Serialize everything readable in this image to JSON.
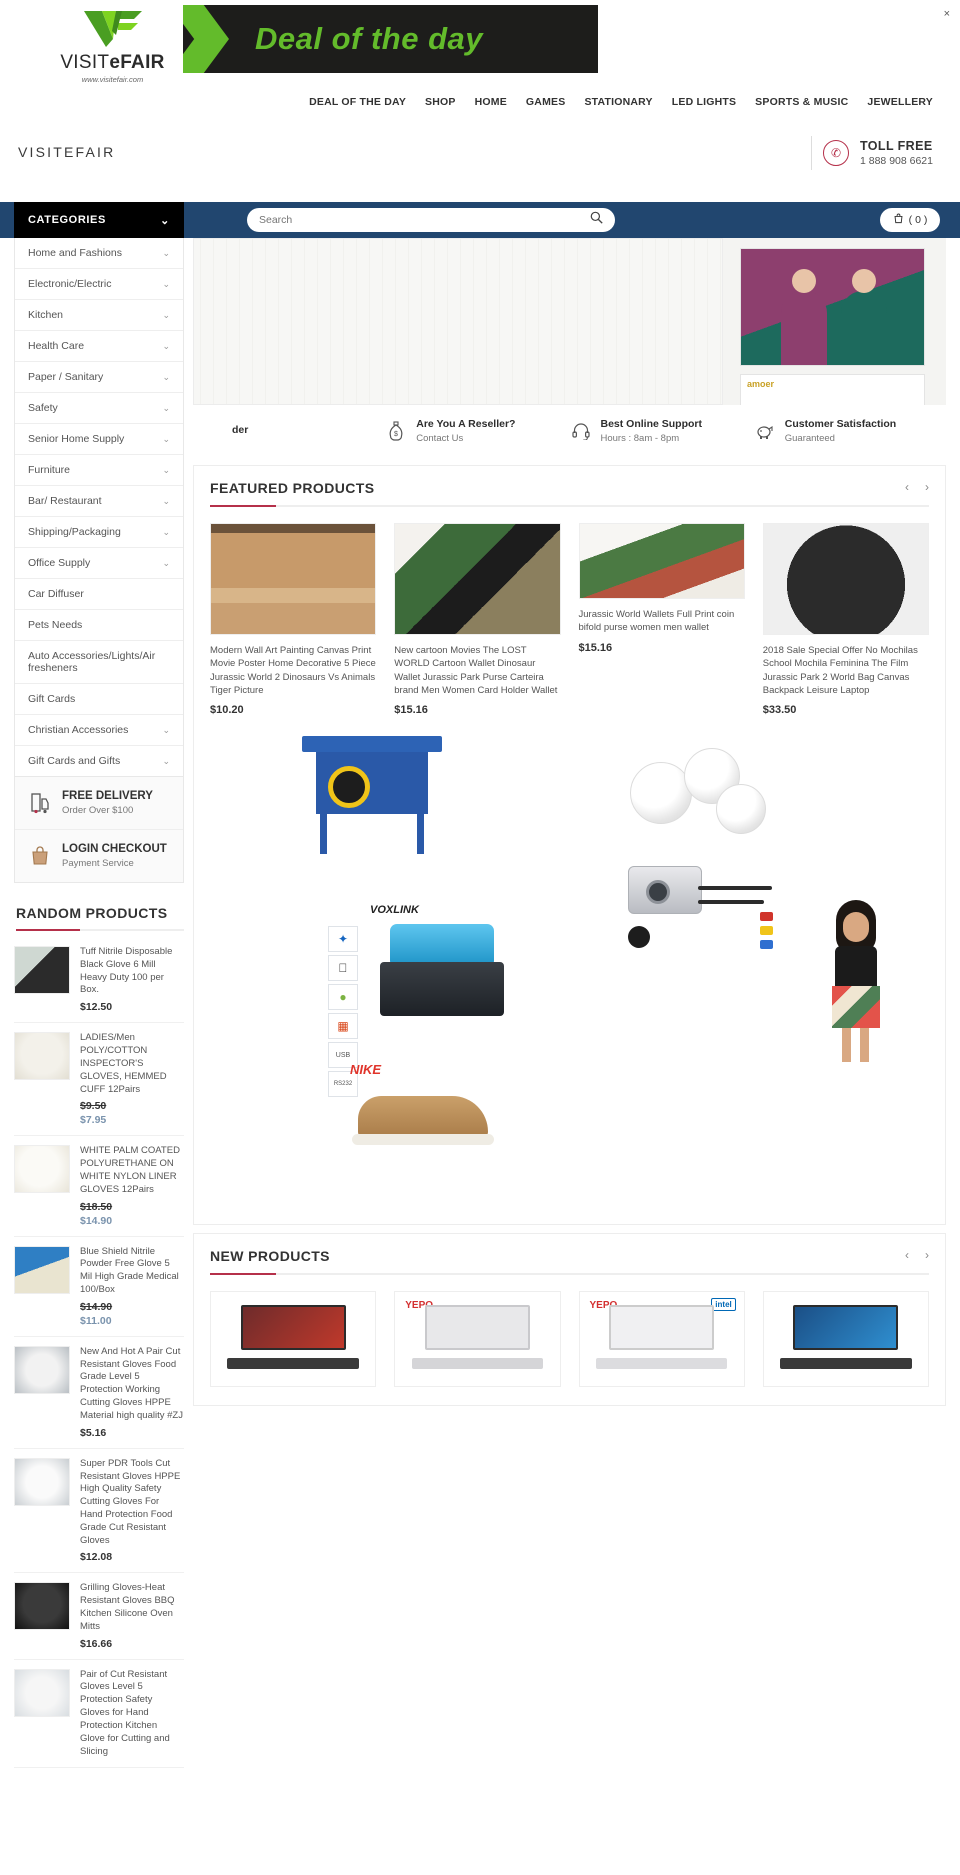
{
  "header": {
    "logo_name_part1": "VISIT",
    "logo_name_part2": "e",
    "logo_name_part3": "FAIR",
    "logo_url": "www.visitefair.com",
    "site_name": "VISITEFAIR",
    "deal_banner_text": "Deal of the day",
    "close_label": "×"
  },
  "nav": {
    "items": [
      {
        "label": "DEAL OF THE DAY"
      },
      {
        "label": "SHOP"
      },
      {
        "label": "HOME"
      },
      {
        "label": "GAMES"
      },
      {
        "label": "STATIONARY"
      },
      {
        "label": "LED LIGHTS"
      },
      {
        "label": "SPORTS & MUSIC"
      },
      {
        "label": "JEWELLERY"
      }
    ]
  },
  "tollfree": {
    "title": "TOLL FREE",
    "number": "1 888 908 6621"
  },
  "search": {
    "categories_label": "CATEGORIES",
    "placeholder": "Search",
    "value": "",
    "cart_label": "( 0 )"
  },
  "sidebar": {
    "categories": [
      {
        "label": "Home and Fashions",
        "expandable": true
      },
      {
        "label": "Electronic/Electric",
        "expandable": true
      },
      {
        "label": "Kitchen",
        "expandable": true
      },
      {
        "label": "Health Care",
        "expandable": true
      },
      {
        "label": "Paper / Sanitary",
        "expandable": true
      },
      {
        "label": "Safety",
        "expandable": true
      },
      {
        "label": "Senior Home Supply",
        "expandable": true
      },
      {
        "label": "Furniture",
        "expandable": true
      },
      {
        "label": "Bar/ Restaurant",
        "expandable": true
      },
      {
        "label": "Shipping/Packaging",
        "expandable": true
      },
      {
        "label": "Office Supply",
        "expandable": true
      },
      {
        "label": "Car Diffuser",
        "expandable": false
      },
      {
        "label": "Pets Needs",
        "expandable": false
      },
      {
        "label": "Auto Accessories/Lights/Air fresheners",
        "expandable": false
      },
      {
        "label": "Gift Cards",
        "expandable": false
      },
      {
        "label": "Christian Accessories",
        "expandable": true
      },
      {
        "label": "Gift Cards and Gifts",
        "expandable": true
      }
    ],
    "promos": [
      {
        "title": "FREE DELIVERY",
        "subtitle": "Order Over $100",
        "icon": "delivery-icon"
      },
      {
        "title": "LOGIN CHECKOUT",
        "subtitle": "Payment Service",
        "icon": "bag-icon"
      }
    ],
    "random_products_title": "RANDOM PRODUCTS",
    "random_products": [
      {
        "title": "Tuff Nitrile Disposable Black Glove 6 Mill Heavy Duty 100 per Box.",
        "price": "$12.50",
        "old_price": "",
        "sale_price": ""
      },
      {
        "title": "LADIES/Men POLY/COTTON INSPECTOR'S GLOVES, HEMMED CUFF 12Pairs",
        "price": "",
        "old_price": "$9.50",
        "sale_price": "$7.95"
      },
      {
        "title": "WHITE PALM COATED POLYURETHANE ON WHITE NYLON LINER GLOVES 12Pairs",
        "price": "",
        "old_price": "$18.50",
        "sale_price": "$14.90"
      },
      {
        "title": "Blue Shield Nitrile Powder Free Glove 5 Mil High Grade Medical 100/Box",
        "price": "",
        "old_price": "$14.90",
        "sale_price": "$11.00"
      },
      {
        "title": "New And Hot A Pair Cut Resistant Gloves Food Grade Level 5 Protection Working Cutting Gloves HPPE Material high quality #ZJ",
        "price": "$5.16",
        "old_price": "",
        "sale_price": ""
      },
      {
        "title": "Super PDR Tools Cut Resistant Gloves HPPE High Quality Safety Cutting Gloves For Hand Protection Food Grade Cut Resistant Gloves",
        "price": "$12.08",
        "old_price": "",
        "sale_price": ""
      },
      {
        "title": "Grilling Gloves-Heat Resistant Gloves BBQ Kitchen Silicone Oven Mitts",
        "price": "$16.66",
        "old_price": "",
        "sale_price": ""
      },
      {
        "title": "Pair of Cut Resistant Gloves Level 5 Protection Safety Gloves for Hand Protection Kitchen Glove for Cutting and Slicing",
        "price": "",
        "old_price": "",
        "sale_price": ""
      }
    ]
  },
  "services": [
    {
      "title": "der",
      "subtitle": "",
      "icon": "truck-icon"
    },
    {
      "title": "Are You A Reseller?",
      "subtitle": "Contact Us",
      "icon": "money-bag-icon"
    },
    {
      "title": "Best Online Support",
      "subtitle": "Hours : 8am - 8pm",
      "icon": "headset-icon"
    },
    {
      "title": "Customer Satisfaction",
      "subtitle": "Guaranteed",
      "icon": "piggy-bank-icon"
    }
  ],
  "featured": {
    "title": "FEATURED PRODUCTS",
    "prev_label": "‹",
    "next_label": "›",
    "products": [
      {
        "title": "Modern Wall Art Painting Canvas Print Movie Poster Home Decorative 5 Piece Jurassic World 2 Dinosaurs Vs Animals Tiger Picture",
        "price": "$10.20"
      },
      {
        "title": "New cartoon Movies The LOST WORLD Cartoon Wallet Dinosaur Wallet Jurassic Park Purse Carteira brand Men Women Card Holder Wallet",
        "price": "$15.16"
      },
      {
        "title": "Jurassic World Wallets Full Print coin bifold purse women men wallet",
        "price": "$15.16"
      },
      {
        "title": "2018 Sale Special Offer No Mochilas School Mochila Feminina The Film Jurassic Park 2 World Bag Canvas Backpack Leisure Laptop",
        "price": "$33.50"
      }
    ]
  },
  "showcase": {
    "voxlink_label": "VOXLINK",
    "nike_label": "NIKE",
    "os_icons": [
      "bluetooth-icon",
      "apple-icon",
      "android-icon",
      "windows-icon",
      "usb-icon",
      "serial-icon"
    ]
  },
  "newproducts": {
    "title": "NEW PRODUCTS",
    "prev_label": "‹",
    "next_label": "›",
    "products": [
      {
        "brand": "",
        "chip": ""
      },
      {
        "brand": "YEPO",
        "chip": ""
      },
      {
        "brand": "YEPO",
        "chip": "intel"
      },
      {
        "brand": "",
        "chip": ""
      }
    ]
  },
  "colors": {
    "accent_red": "#b5304a",
    "nav_blue": "#21466f",
    "green": "#63bb2b",
    "sale_blue": "#7a93ad"
  }
}
